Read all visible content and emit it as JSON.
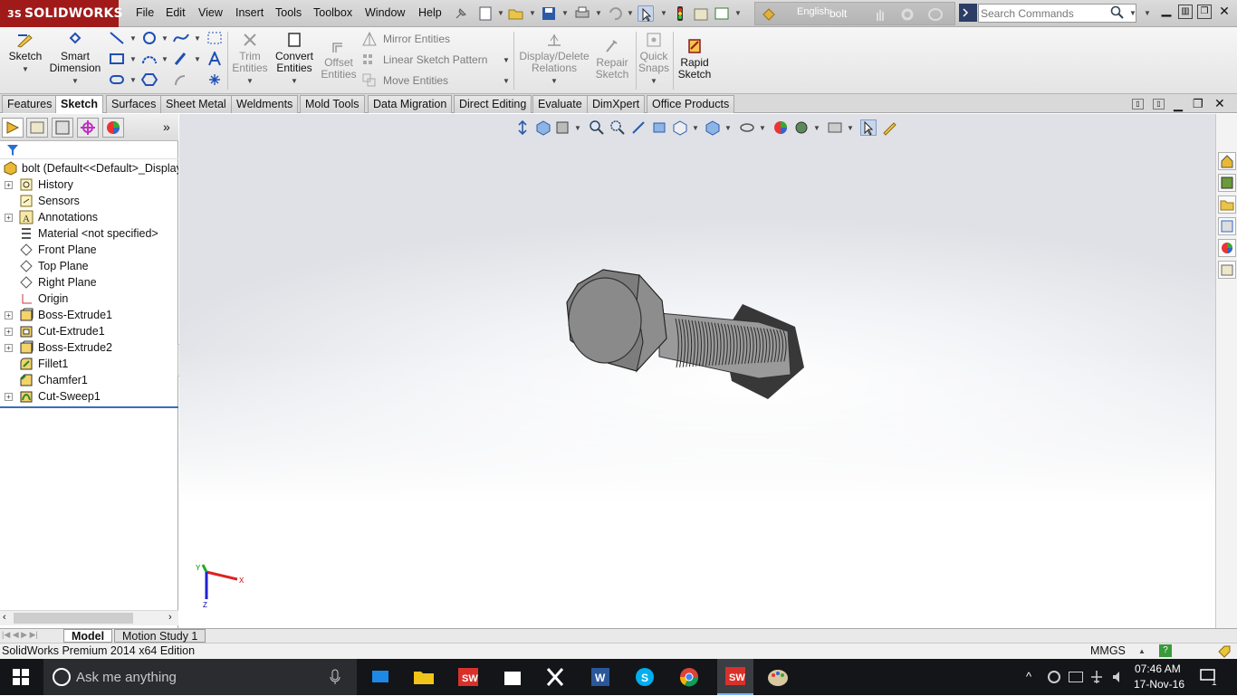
{
  "app": {
    "brand": "SOLIDWORKS",
    "brand_prefix": "3S",
    "document_name": "bolt",
    "language": "English",
    "search_placeholder": "Search Commands"
  },
  "menu": [
    "File",
    "Edit",
    "View",
    "Insert",
    "Tools",
    "Toolbox",
    "Window",
    "Help"
  ],
  "command_manager": {
    "sketch": "Sketch",
    "smart_dimension_1": "Smart",
    "smart_dimension_2": "Dimension",
    "trim_1": "Trim",
    "trim_2": "Entities",
    "convert_1": "Convert",
    "convert_2": "Entities",
    "offset_1": "Offset",
    "offset_2": "Entities",
    "mirror": "Mirror Entities",
    "linear_pattern": "Linear Sketch Pattern",
    "move": "Move Entities",
    "display_delete_1": "Display/Delete",
    "display_delete_2": "Relations",
    "repair_1": "Repair",
    "repair_2": "Sketch",
    "quick_snaps_1": "Quick",
    "quick_snaps_2": "Snaps",
    "rapid_1": "Rapid",
    "rapid_2": "Sketch"
  },
  "tabs": [
    "Features",
    "Sketch",
    "Surfaces",
    "Sheet Metal",
    "Weldments",
    "Mold Tools",
    "Data Migration",
    "Direct Editing",
    "Evaluate",
    "DimXpert",
    "Office Products"
  ],
  "active_tab": "Sketch",
  "feature_tree": {
    "root": "bolt  (Default<<Default>_Display",
    "items": [
      {
        "label": "History",
        "icon": "history-icon",
        "expandable": true
      },
      {
        "label": "Sensors",
        "icon": "sensor-icon",
        "expandable": false
      },
      {
        "label": "Annotations",
        "icon": "annotation-icon",
        "expandable": true
      },
      {
        "label": "Material <not specified>",
        "icon": "material-icon",
        "expandable": false
      },
      {
        "label": "Front Plane",
        "icon": "plane-icon",
        "expandable": false
      },
      {
        "label": "Top Plane",
        "icon": "plane-icon",
        "expandable": false
      },
      {
        "label": "Right Plane",
        "icon": "plane-icon",
        "expandable": false
      },
      {
        "label": "Origin",
        "icon": "origin-icon",
        "expandable": false
      },
      {
        "label": "Boss-Extrude1",
        "icon": "extrude-icon",
        "expandable": true
      },
      {
        "label": "Cut-Extrude1",
        "icon": "cut-extrude-icon",
        "expandable": true
      },
      {
        "label": "Boss-Extrude2",
        "icon": "extrude-icon",
        "expandable": true
      },
      {
        "label": "Fillet1",
        "icon": "fillet-icon",
        "expandable": false
      },
      {
        "label": "Chamfer1",
        "icon": "chamfer-icon",
        "expandable": false
      },
      {
        "label": "Cut-Sweep1",
        "icon": "sweep-icon",
        "expandable": true
      }
    ]
  },
  "bottom_tabs": [
    "Model",
    "Motion Study 1"
  ],
  "status": {
    "edition": "SolidWorks Premium 2014 x64 Edition",
    "units": "MMGS"
  },
  "triad": {
    "x": "X",
    "y": "Y",
    "z": "Z"
  },
  "taskbar": {
    "search_placeholder": "Ask me anything",
    "time": "07:46 AM",
    "date": "17-Nov-16",
    "notification_count": "1"
  },
  "colors": {
    "brand_red": "#a01a1a",
    "taskbar": "#131518",
    "model_gray": "#8c8c8c"
  }
}
